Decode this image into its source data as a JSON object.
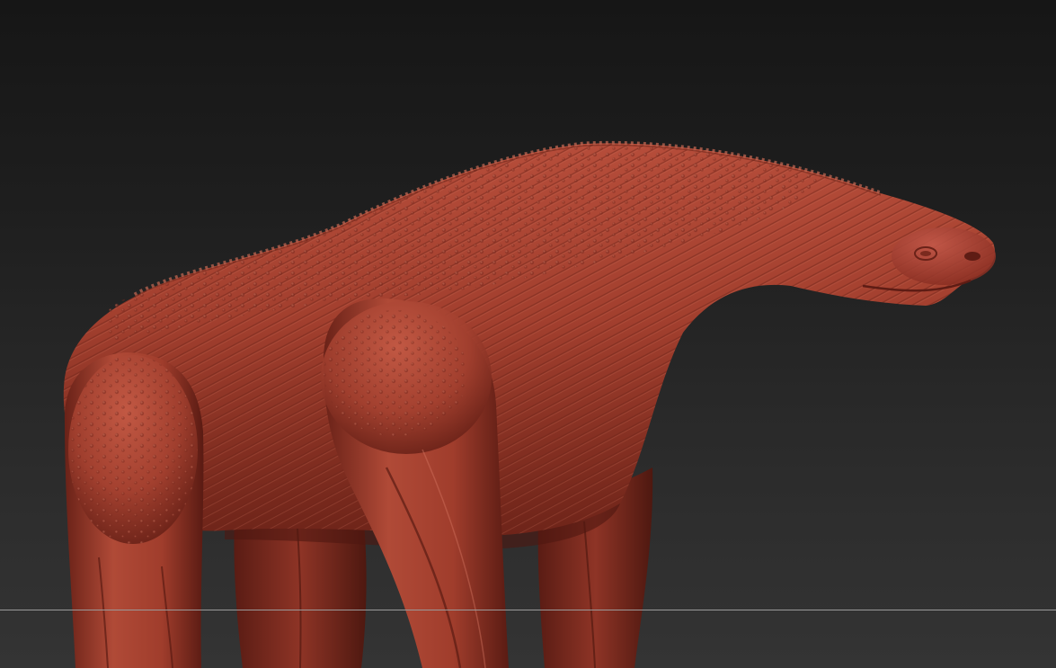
{
  "viewport": {
    "background_top": "#161616",
    "background_bottom": "#343434"
  },
  "model": {
    "material_color": "#a8402f",
    "material_shadow": "#5e1c14",
    "material_highlight": "#d26c56"
  },
  "floor_grid": {
    "color": "#9a9a9a"
  }
}
